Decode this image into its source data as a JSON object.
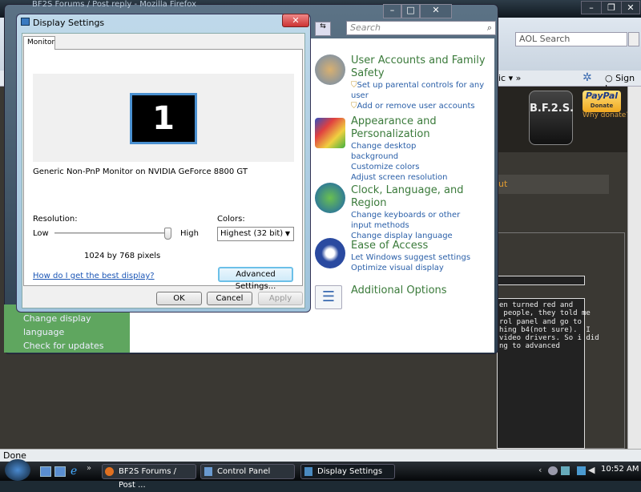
{
  "firefox": {
    "window_title": "BF2S Forums / Post reply - Mozilla Firefox",
    "search_placeholder": "AOL Search",
    "nav_fragment": "ic ▾ »",
    "sign_in": "○ Sign In",
    "status": "Done",
    "logo_text": "B.F.2.S.",
    "paypal": "PayPal",
    "donate": "Donate",
    "why_donate": "Why donate?",
    "panel_text": "ut",
    "post_text": "en turned red and\n people, they told me\nrol panel and go to\nhing b4(not sure).  I\nvideo drivers. So i did\nng to advanced"
  },
  "control_panel": {
    "search_placeholder": "Search",
    "left_links": [
      "Change display language",
      "Check for updates"
    ],
    "categories": [
      {
        "title": "User Accounts and Family Safety",
        "links": [
          "Set up parental controls for any user",
          "Add or remove user accounts"
        ],
        "icon": "users-icon"
      },
      {
        "title": "Appearance and Personalization",
        "links": [
          "Change desktop background",
          "Customize colors",
          "Adjust screen resolution"
        ],
        "icon": "appearance-icon"
      },
      {
        "title": "Clock, Language, and Region",
        "links": [
          "Change keyboards or other input methods",
          "Change display language"
        ],
        "icon": "globe-clock-icon"
      },
      {
        "title": "Ease of Access",
        "links": [
          "Let Windows suggest settings",
          "Optimize visual display"
        ],
        "icon": "ease-of-access-icon"
      },
      {
        "title": "Additional Options",
        "links": [],
        "icon": "checklist-icon"
      }
    ]
  },
  "dialog": {
    "title": "Display Settings",
    "tab": "Monitor",
    "monitor_number": "1",
    "monitor_desc": "Generic Non-PnP Monitor on NVIDIA GeForce 8800 GT",
    "resolution_label": "Resolution:",
    "low": "Low",
    "high": "High",
    "resolution_value": "1024 by 768 pixels",
    "slider_level": 1.0,
    "colors_label": "Colors:",
    "colors_value": "Highest (32 bit)",
    "help_link": "How do I get the best display?",
    "advanced": "Advanced Settings...",
    "ok": "OK",
    "cancel": "Cancel",
    "apply": "Apply",
    "accent": "#4a90d0"
  },
  "taskbar": {
    "items": [
      "BF2S Forums / Post ...",
      "Control Panel",
      "Display Settings"
    ],
    "clock": "10:52 AM",
    "more": "»"
  }
}
